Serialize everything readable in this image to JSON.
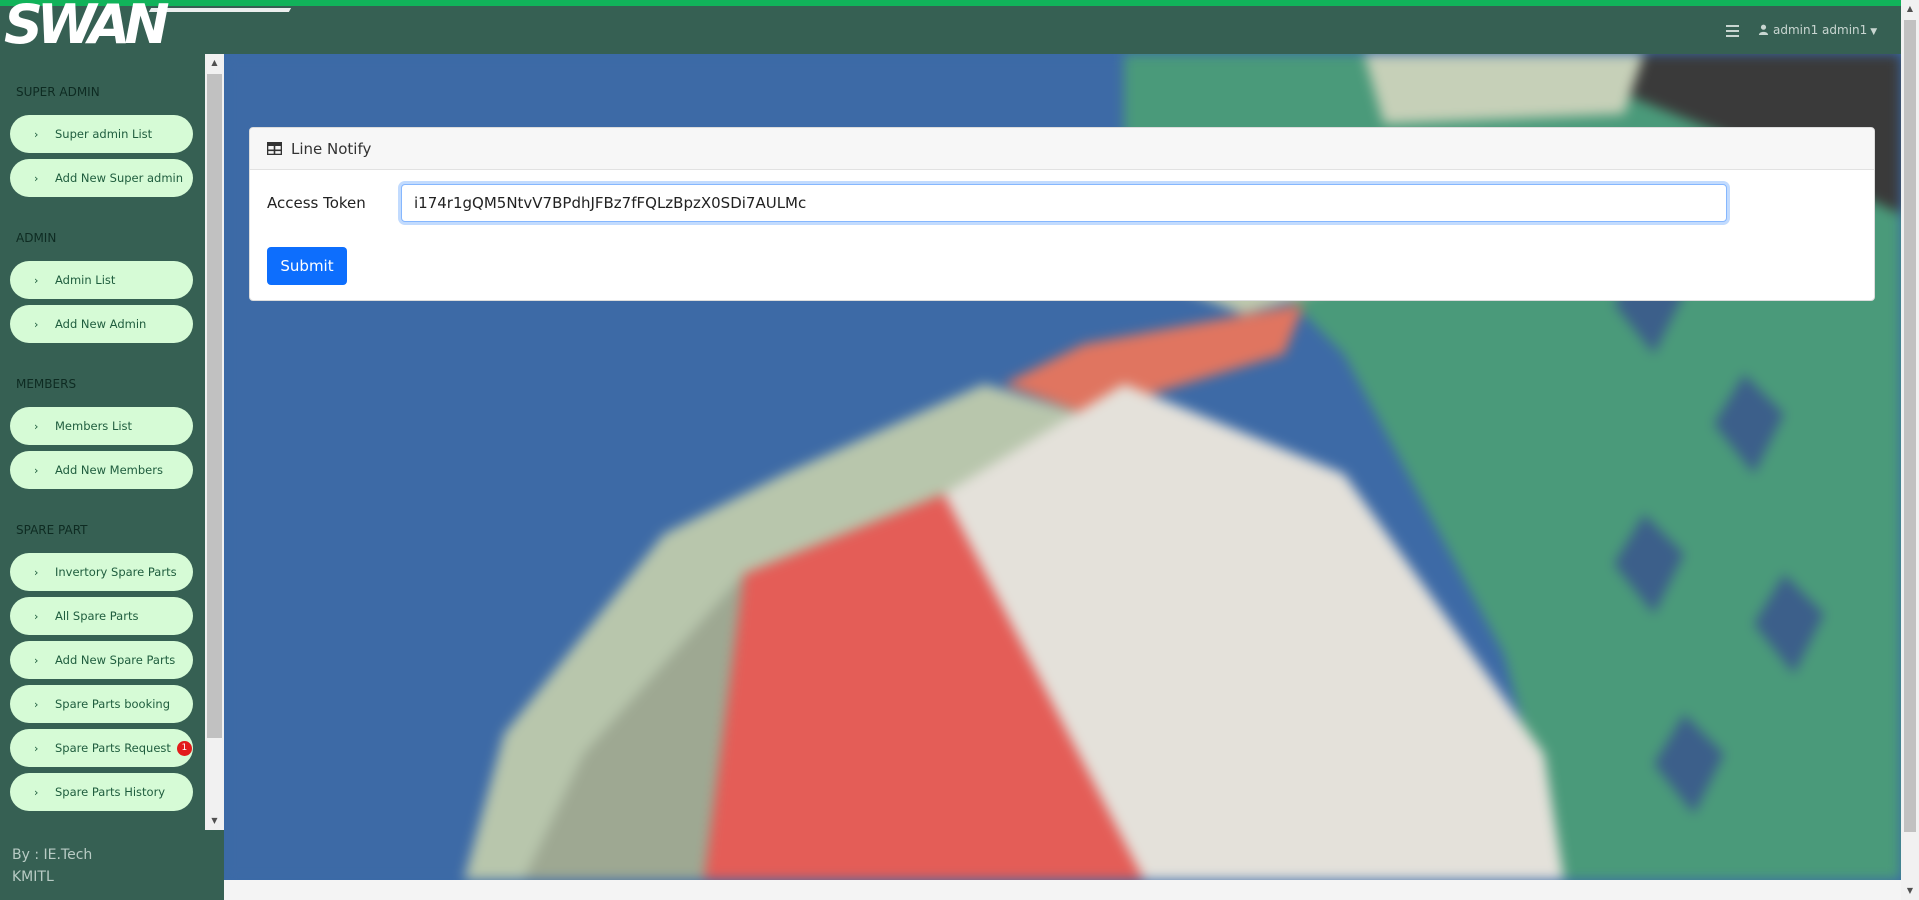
{
  "brand": {
    "logo_text": "SWAN"
  },
  "header": {
    "user_label": "admin1 admin1"
  },
  "sidebar": {
    "sections": [
      {
        "title": "SUPER ADMIN",
        "items": [
          {
            "label": "Super admin List"
          },
          {
            "label": "Add New Super admin"
          }
        ]
      },
      {
        "title": "ADMIN",
        "items": [
          {
            "label": "Admin List"
          },
          {
            "label": "Add New Admin"
          }
        ]
      },
      {
        "title": "MEMBERS",
        "items": [
          {
            "label": "Members List"
          },
          {
            "label": "Add New Members"
          }
        ]
      },
      {
        "title": "SPARE PART",
        "items": [
          {
            "label": "Invertory Spare Parts"
          },
          {
            "label": "All Spare Parts"
          },
          {
            "label": "Add New Spare Parts"
          },
          {
            "label": "Spare Parts booking"
          },
          {
            "label": "Spare Parts Request",
            "badge": "1"
          },
          {
            "label": "Spare Parts History"
          }
        ]
      }
    ],
    "credit_line1": "By : IE.Tech",
    "credit_line2": "KMITL"
  },
  "card": {
    "title": "Line Notify",
    "field_label": "Access Token",
    "token_value": "i174r1gQM5NtvV7BPdhJFBz7fFQLzBpzX0SDi7AULMc",
    "submit_label": "Submit"
  },
  "colors": {
    "accent": "#0d6efd",
    "nav_bg": "#d6fbd6",
    "sidebar_bg": "#366053",
    "top_stripe": "#11b35a",
    "badge": "#e21b1b"
  }
}
